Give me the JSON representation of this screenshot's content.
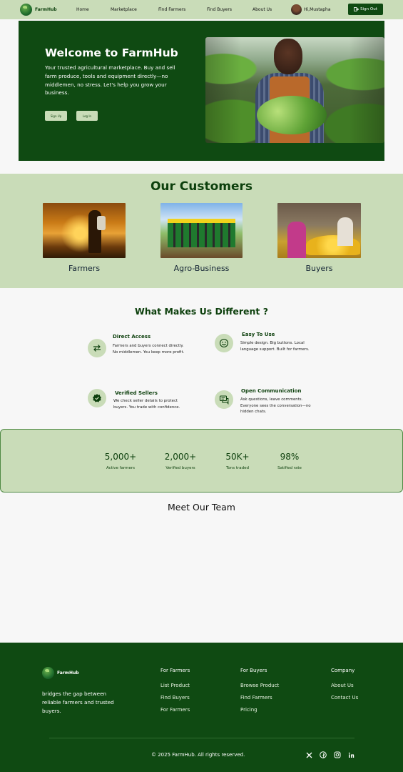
{
  "colors": {
    "primary": "#0f4a12",
    "light": "#c9dcb8",
    "background": "#f7f7f7"
  },
  "nav": {
    "brand": "FarmHub",
    "links": [
      "Home",
      "Marketplace",
      "Find Farmers",
      "Find Buyers",
      "About Us"
    ],
    "user_name": "Hi,Mustapha",
    "signout_label": "Sign Out",
    "signout_icon": "sign-out-icon"
  },
  "hero": {
    "title": "Welcome to FarmHub",
    "text": "Your trusted agricultural marketplace. Buy and sell farm produce, tools and equipment directly—no middlemen, no stress. Let's help you grow your business.",
    "signup_label": "Sign Up",
    "login_label": "Log In"
  },
  "customers": {
    "title": "Our Customers",
    "items": [
      {
        "label": "Farmers"
      },
      {
        "label": "Agro-Business"
      },
      {
        "label": "Buyers"
      }
    ]
  },
  "features": {
    "title": "What Makes Us Different ?",
    "items": [
      {
        "title": "Direct Access",
        "text": "Farmers and buyers connect directly. No middlemen. You keep more profit.",
        "icon": "exchange-arrows-icon"
      },
      {
        "title": "Easy To Use",
        "text": "Simple design. Big buttons. Local language support. Built for farmers.",
        "icon": "smiley-icon"
      },
      {
        "title": "Verified Sellers",
        "text": "We check seller details to protect buyers. You trade with confidence.",
        "icon": "verified-badge-icon"
      },
      {
        "title": "Open Communication",
        "text": "Ask questions, leave comments. Everyone sees the conversation—no hidden chats.",
        "icon": "chat-icon"
      }
    ]
  },
  "stats": [
    {
      "value": "5,000+",
      "label": "Active farmers"
    },
    {
      "value": "2,000+",
      "label": "Verified buyers"
    },
    {
      "value": "50K+",
      "label": "Tons traded"
    },
    {
      "value": "98%",
      "label": "Satified rate"
    }
  ],
  "team": {
    "title": "Meet Our Team"
  },
  "footer": {
    "brand": "FarmHub",
    "tagline": "bridges the gap between reliable farmers and trusted buyers.",
    "columns": [
      {
        "heading": "For Farmers",
        "links": [
          "List Product",
          "Find Buyers",
          "For Farmers"
        ]
      },
      {
        "heading": "For Buyers",
        "links": [
          "Browse Product",
          "Find Farmers",
          "Pricing"
        ]
      },
      {
        "heading": "Company",
        "links": [
          "About Us",
          "Contact Us"
        ]
      }
    ],
    "copyright": "© 2025 FarmHub. All rights reserved.",
    "socials": [
      "x-icon",
      "facebook-icon",
      "instagram-icon",
      "linkedin-icon"
    ]
  }
}
